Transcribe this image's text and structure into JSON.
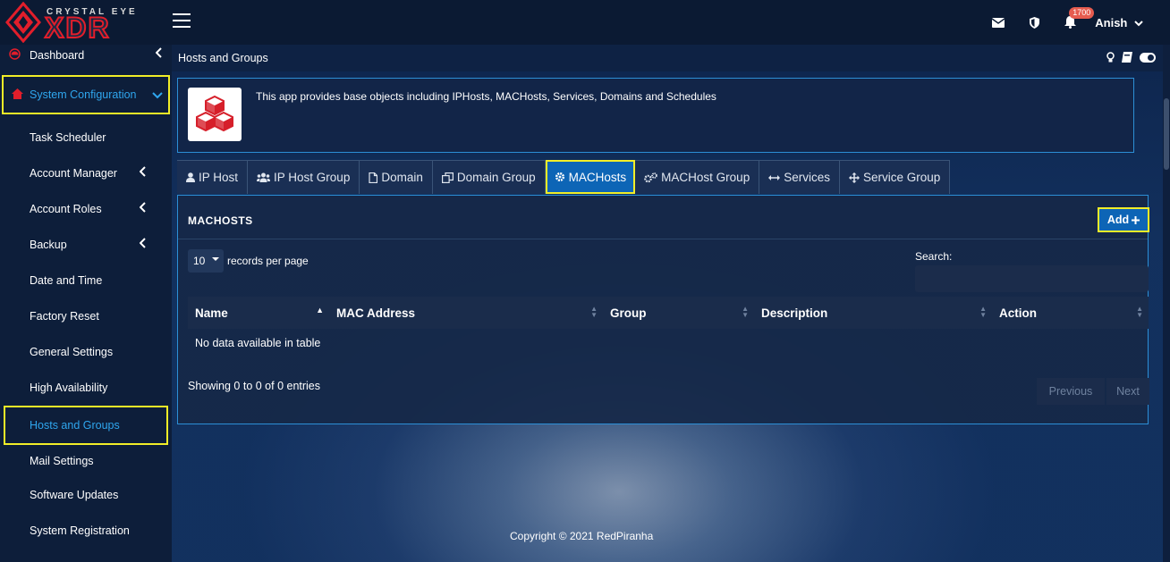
{
  "brand": {
    "small": "CRYSTAL EYE",
    "big": "XDR"
  },
  "topbar": {
    "notification_count": "1700",
    "user_name": "Anish"
  },
  "sidebar": {
    "dashboard": "Dashboard",
    "system_configuration": "System Configuration",
    "items": [
      {
        "label": "Task Scheduler",
        "arrow": false
      },
      {
        "label": "Account Manager",
        "arrow": true
      },
      {
        "label": "Account Roles",
        "arrow": true
      },
      {
        "label": "Backup",
        "arrow": true
      },
      {
        "label": "Date and Time",
        "arrow": false
      },
      {
        "label": "Factory Reset",
        "arrow": false
      },
      {
        "label": "General Settings",
        "arrow": false
      },
      {
        "label": "High Availability",
        "arrow": false
      },
      {
        "label": "Hosts and Groups",
        "arrow": false,
        "active": true
      },
      {
        "label": "Mail Settings",
        "arrow": false
      },
      {
        "label": "Software Updates",
        "arrow": false
      },
      {
        "label": "System Registration",
        "arrow": false
      }
    ]
  },
  "main": {
    "page_title": "Hosts and Groups",
    "info_text": "This app provides base objects including IPHosts, MACHosts, Services, Domains and Schedules",
    "tabs": [
      {
        "label": "IP Host",
        "icon": "user-icon"
      },
      {
        "label": "IP Host Group",
        "icon": "users-icon"
      },
      {
        "label": "Domain",
        "icon": "file-icon"
      },
      {
        "label": "Domain Group",
        "icon": "copy-icon"
      },
      {
        "label": "MACHosts",
        "icon": "gear-icon",
        "active": true
      },
      {
        "label": "MACHost Group",
        "icon": "gears-icon"
      },
      {
        "label": "Services",
        "icon": "arrows-h-icon"
      },
      {
        "label": "Service Group",
        "icon": "arrows-icon"
      }
    ],
    "panel": {
      "title": "MACHOSTS",
      "add_label": "Add",
      "length_value": "10",
      "length_label": "records per page",
      "search_label": "Search:",
      "search_value": "",
      "columns": [
        "Name",
        "MAC Address",
        "Group",
        "Description",
        "Action"
      ],
      "empty_text": "No data available in table",
      "showing_text": "Showing 0 to 0 of 0 entries",
      "previous_label": "Previous",
      "next_label": "Next"
    },
    "footer": "Copyright © 2021 RedPiranha"
  }
}
